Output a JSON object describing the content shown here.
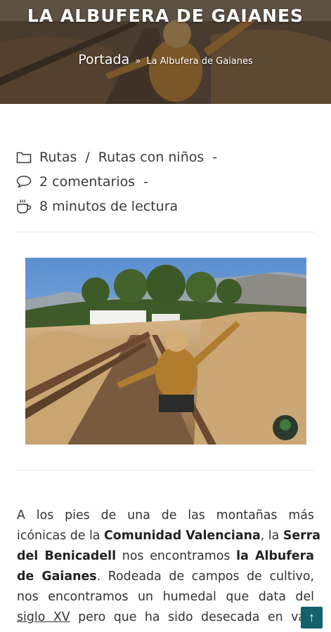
{
  "hero": {
    "title": "LA ALBUFERA DE GAIANES",
    "breadcrumb": {
      "home": "Portada",
      "separator": "»",
      "current": "La Albufera de Gaianes"
    }
  },
  "meta": {
    "categories": [
      "Rutas",
      "Rutas con niños"
    ],
    "category_separator": "/",
    "comments": "2 comentarios",
    "reading_time": "8 minutos de lectura",
    "dash": "-",
    "icons": [
      "folder-icon",
      "comment-bubble-icon",
      "coffee-cup-icon"
    ]
  },
  "featured_image": {
    "alt": "",
    "badge": "icon"
  },
  "article": {
    "lines": [
      [
        "A los pies de una de las montañas más"
      ],
      [
        "icónicas de la ",
        "Comunidad Valenciana",
        ", la ",
        "Serra"
      ],
      [
        "del Benicadell",
        " nos encontramos ",
        "la Albufera"
      ],
      [
        "de Gaianes",
        ". Rodeada de campos de cultivo,"
      ],
      [
        "nos encontramos un humedal que data del"
      ],
      [
        "siglo XV",
        " pero que ha sido desecada en vari"
      ]
    ]
  },
  "scroll_top": {
    "glyph": "↑"
  },
  "colors": {
    "accent": "#13606e",
    "text": "#333333",
    "divider": "#e6e6e6"
  }
}
